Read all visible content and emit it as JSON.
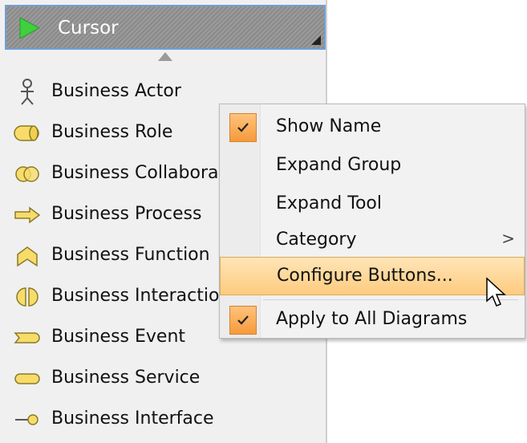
{
  "palette": {
    "cursor": {
      "label": "Cursor"
    },
    "items": [
      {
        "label": "Business Actor",
        "icon": "business-actor-icon"
      },
      {
        "label": "Business Role",
        "icon": "business-role-icon"
      },
      {
        "label": "Business Collaboratio",
        "icon": "business-collaboration-icon"
      },
      {
        "label": "Business Process",
        "icon": "business-process-icon"
      },
      {
        "label": "Business Function",
        "icon": "business-function-icon"
      },
      {
        "label": "Business Interaction",
        "icon": "business-interaction-icon"
      },
      {
        "label": "Business Event",
        "icon": "business-event-icon"
      },
      {
        "label": "Business Service",
        "icon": "business-service-icon"
      },
      {
        "label": "Business Interface",
        "icon": "business-interface-icon"
      }
    ]
  },
  "context_menu": {
    "items": [
      {
        "label": "Show Name",
        "checked": true
      },
      {
        "label": "Expand Group",
        "checked": false
      },
      {
        "label": "Expand Tool",
        "checked": false
      },
      {
        "label": "Category",
        "checked": false,
        "submenu_arrow": ">"
      },
      {
        "label": "Configure Buttons...",
        "checked": false,
        "highlighted": true
      },
      {
        "label": "Apply to All Diagrams",
        "checked": true
      }
    ]
  },
  "colors": {
    "accent_check": "#f59a3c",
    "highlight": "#fdcb7e",
    "selection_border": "#6f9fd6"
  }
}
